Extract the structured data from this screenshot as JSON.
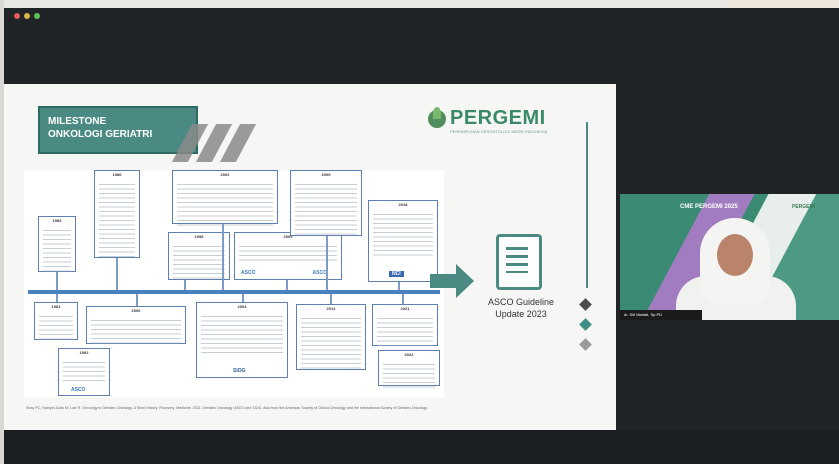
{
  "window": {
    "controls": [
      {
        "name": "close-dot",
        "color": "#e05c54"
      },
      {
        "name": "minimize-dot",
        "color": "#e0b44a"
      },
      {
        "name": "maximize-dot",
        "color": "#5cbf5c"
      }
    ]
  },
  "slide": {
    "title_line1": "MILESTONE",
    "title_line2": "ONKOLOGI GERIATRI",
    "logo_text": "PERGEMI",
    "logo_tagline": "PERHIMPUNAN GERONTOLOGI MEDIK INDONESIA",
    "doc_label_line1": "ASCO Guideline",
    "doc_label_line2": "Update 2023",
    "top_boxes": [
      {
        "year": "1983"
      },
      {
        "year": "1986"
      },
      {
        "year": "1998"
      },
      {
        "year": "2002"
      },
      {
        "year": "2005"
      },
      {
        "year": "2009"
      },
      {
        "year": "2018"
      }
    ],
    "bottom_boxes": [
      {
        "year": "1981"
      },
      {
        "year": "1992"
      },
      {
        "year": "2000"
      },
      {
        "year": "2004"
      },
      {
        "year": "2012"
      },
      {
        "year": "2021"
      },
      {
        "year": "2022"
      }
    ],
    "inline_logos": [
      "ASCO",
      "ASCO",
      "SIOG",
      "NCI"
    ],
    "references": "Shay PC, Hampel-Gulik M, Lutz R. Oncology in Geriatric Oncology. A Short History. Recovery. Medicine. 2021. Geriatric Oncology: ASCO and SIOG. Also from the American Society of Clinical Oncology and the International Society of Geriatric Oncology.",
    "accent_color": "#4a8a82"
  },
  "pager": {
    "dots": [
      {
        "color": "#4d4d4d"
      },
      {
        "color": "#3f8f86"
      },
      {
        "color": "#9a9a9a"
      }
    ]
  },
  "video": {
    "banner_title": "CME PERGEMI 2025",
    "banner_logo": "PERGEMI",
    "speaker_name": "dr. Siti Mariati, Sp.PD"
  }
}
